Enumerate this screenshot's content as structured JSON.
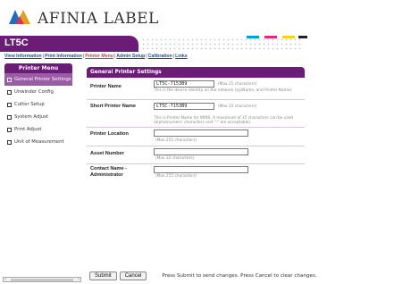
{
  "header": {
    "logo_text": "AFINIA LABEL",
    "model": "LT5C"
  },
  "nav": {
    "links": [
      {
        "label": "View Information",
        "active": false
      },
      {
        "label": "Print Information",
        "active": false
      },
      {
        "label": "Printer Menu",
        "active": true
      },
      {
        "label": "Admin Setup",
        "active": false
      },
      {
        "label": "Calibration",
        "active": false
      },
      {
        "label": "Links",
        "active": false
      }
    ]
  },
  "sidebar": {
    "title": "Printer Menu",
    "items": [
      {
        "label": "General Printer Settings",
        "active": true
      },
      {
        "label": "Unwinder Config",
        "active": false
      },
      {
        "label": "Cutter Setup",
        "active": false
      },
      {
        "label": "System Adjust",
        "active": false
      },
      {
        "label": "Print Adjust",
        "active": false
      },
      {
        "label": "Unit of Measurement",
        "active": false
      }
    ]
  },
  "main": {
    "title": "General Printer Settings",
    "printer_name": {
      "label": "Printer Name",
      "value": "LT5C-7153B9",
      "max_hint": "(Max.31 characters)",
      "description": "This is the device identity on the network (sysName, and Printer Name)."
    },
    "short_name": {
      "label": "Short Printer Name",
      "value": "LT5C-7153B9",
      "max_hint": "(Max.15 characters)",
      "description": "This is Printer Name for WINS. A maximum of 15 characters can be used (alpha/numeric characters and \"-\" are acceptable)."
    },
    "location": {
      "label": "Printer Location",
      "value": "",
      "max_hint": "(Max.255 characters)"
    },
    "asset": {
      "label": "Asset Number",
      "value": "",
      "max_hint": "(Max.32 characters)"
    },
    "contact": {
      "label": "Contact Name - Administrator",
      "value": "",
      "max_hint": "(Max.255 characters)"
    }
  },
  "footer": {
    "submit_label": "Submit",
    "cancel_label": "Cancel",
    "message": "Press Submit to send changes. Press Cancel to clear changes."
  },
  "colors": {
    "brand_purple": "#6a1c76",
    "active_item": "#9b5ca6",
    "nav_link": "#1a4d9e",
    "nav_active": "#d0365c"
  }
}
